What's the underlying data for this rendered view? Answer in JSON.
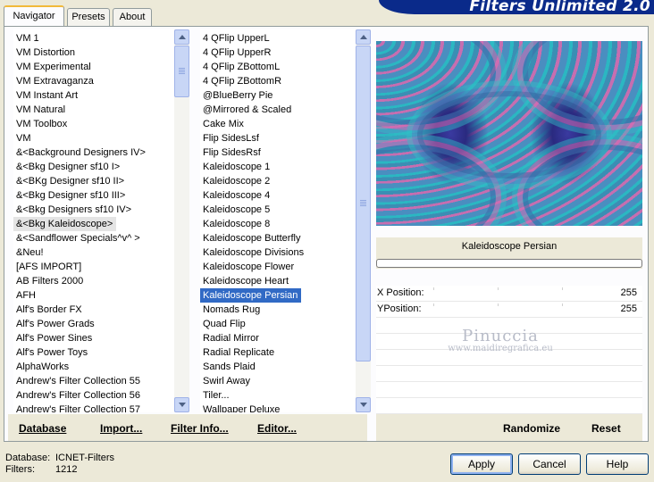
{
  "banner": {
    "title": "Filters Unlimited 2.0"
  },
  "tabs": [
    {
      "label": "Navigator",
      "active": true
    },
    {
      "label": "Presets",
      "active": false
    },
    {
      "label": "About",
      "active": false
    }
  ],
  "categories": {
    "items": [
      "VM 1",
      "VM Distortion",
      "VM Experimental",
      "VM Extravaganza",
      "VM Instant Art",
      "VM Natural",
      "VM Toolbox",
      "VM",
      "&<Background Designers IV>",
      "&<Bkg Designer sf10 I>",
      "&<BKg Designer sf10 II>",
      "&<Bkg Designer sf10 III>",
      "&<Bkg Designers sf10 IV>",
      "&<Bkg Kaleidoscope>",
      "&<Sandflower Specials^v^ >",
      "&Neu!",
      "[AFS IMPORT]",
      "AB Filters 2000",
      "AFH",
      "Alf's Border FX",
      "Alf's Power Grads",
      "Alf's Power Sines",
      "Alf's Power Toys",
      "AlphaWorks",
      "Andrew's Filter Collection 55",
      "Andrew's Filter Collection 56",
      "Andrew's Filter Collection 57"
    ],
    "selected_index": 13
  },
  "filters": {
    "items": [
      "4 QFlip UpperL",
      "4 QFlip UpperR",
      "4 QFlip ZBottomL",
      "4 QFlip ZBottomR",
      "@BlueBerry Pie",
      "@Mirrored & Scaled",
      "Cake Mix",
      "Flip SidesLsf",
      "Flip SidesRsf",
      "Kaleidoscope 1",
      "Kaleidoscope 2",
      "Kaleidoscope 4",
      "Kaleidoscope 5",
      "Kaleidoscope 8",
      "Kaleidoscope Butterfly",
      "Kaleidoscope Divisions",
      "Kaleidoscope Flower",
      "Kaleidoscope Heart",
      "Kaleidoscope Persian",
      "Nomads Rug",
      "Quad Flip",
      "Radial Mirror",
      "Radial Replicate",
      "Sands Plaid",
      "Swirl Away",
      "Tiler...",
      "Wallpaper Deluxe"
    ],
    "selected_index": 18
  },
  "preview": {
    "filter_name": "Kaleidoscope Persian"
  },
  "params": [
    {
      "label": "X Position:",
      "value": "255"
    },
    {
      "label": "YPosition:",
      "value": "255"
    }
  ],
  "watermark": {
    "name": "Pinuccia",
    "url": "www.maidiregrafica.eu"
  },
  "toolbar": {
    "database": "Database",
    "import": "Import...",
    "filter_info": "Filter Info...",
    "editor": "Editor...",
    "randomize": "Randomize",
    "reset": "Reset"
  },
  "footer": {
    "database_label": "Database:",
    "database_value": "ICNET-Filters",
    "filters_label": "Filters:",
    "filters_value": "1212"
  },
  "buttons": {
    "apply": "Apply",
    "cancel": "Cancel",
    "help": "Help"
  },
  "colors": {
    "selection": "#316ac5",
    "banner": "#0a2a8a",
    "face": "#ece9d8"
  }
}
